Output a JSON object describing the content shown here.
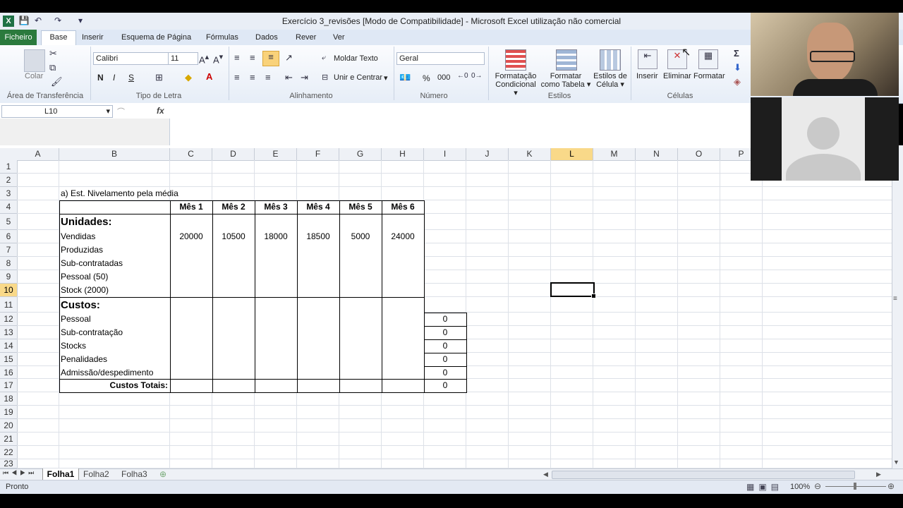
{
  "window": {
    "title": "Exercício 3_revisões  [Modo de Compatibilidade]  -  Microsoft Excel utilização não comercial"
  },
  "ribbon_tabs": [
    "Ficheiro",
    "Base",
    "Inserir",
    "Esquema de Página",
    "Fórmulas",
    "Dados",
    "Rever",
    "Ver"
  ],
  "ribbon": {
    "clipboard": {
      "paste_label": "Colar",
      "group_label": "Área de Transferência"
    },
    "font": {
      "font_name": "Calibri",
      "font_size": "11",
      "bold": "N",
      "italic": "I",
      "underline": "S",
      "group_label": "Tipo de Letra"
    },
    "alignment": {
      "wrap_text": "Moldar Texto",
      "merge_center": "Unir e Centrar",
      "group_label": "Alinhamento"
    },
    "number": {
      "format": "Geral",
      "percent": "%",
      "thousands": "000",
      "group_label": "Número"
    },
    "styles": {
      "conditional": [
        "Formatação",
        "Condicional"
      ],
      "as_table": [
        "Formatar",
        "como Tabela"
      ],
      "cell_styles": [
        "Estilos de",
        "Célula"
      ],
      "group_label": "Estilos"
    },
    "cells": {
      "insert": "Inserir",
      "delete": "Eliminar",
      "format": "Formatar",
      "group_label": "Células"
    }
  },
  "formula_bar": {
    "name_box": "L10",
    "fx": "fx",
    "formula": ""
  },
  "columns": [
    "A",
    "B",
    "C",
    "D",
    "E",
    "F",
    "G",
    "H",
    "I",
    "J",
    "K",
    "L",
    "M",
    "N",
    "O",
    "P"
  ],
  "rows": [
    "1",
    "2",
    "3",
    "4",
    "5",
    "6",
    "7",
    "8",
    "9",
    "10",
    "11",
    "12",
    "13",
    "14",
    "15",
    "16",
    "17",
    "18",
    "19",
    "20",
    "21",
    "22",
    "23"
  ],
  "sheet": {
    "heading": "a) Est. Nivelamento pela média",
    "months": [
      "Mês 1",
      "Mês 2",
      "Mês 3",
      "Mês 4",
      "Mês 5",
      "Mês 6"
    ],
    "units_title": "Unidades:",
    "units_rows": [
      "Vendidas",
      "Produzidas",
      "Sub-contratadas",
      "Pessoal (50)",
      "Stock (2000)"
    ],
    "sales_values": [
      "20000",
      "10500",
      "18000",
      "18500",
      "5000",
      "24000"
    ],
    "costs_title": "Custos:",
    "cost_rows": [
      "Pessoal",
      "Sub-contratação",
      "Stocks",
      "Penalidades",
      "Admissão/despedimento"
    ],
    "total_label": "Custos Totais:",
    "cost_totals": [
      "0",
      "0",
      "0",
      "0",
      "0",
      "0"
    ]
  },
  "sheet_tabs": [
    "Folha1",
    "Folha2",
    "Folha3"
  ],
  "status": {
    "ready": "Pronto",
    "zoom": "100%"
  },
  "colors": {
    "excel_green": "#2b7a3d",
    "header_active": "#f9d989",
    "ribbon_bg": "#dfe8f5"
  }
}
